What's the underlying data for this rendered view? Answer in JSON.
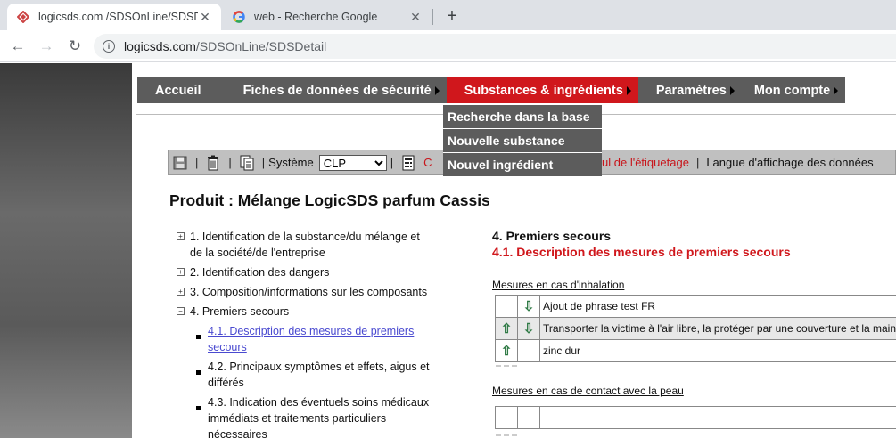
{
  "browser": {
    "tabs": [
      {
        "title": "logicsds.com /SDSOnLine/SDSDe",
        "active": true
      },
      {
        "title": "web - Recherche Google",
        "active": false
      }
    ],
    "url_host": "logicsds.com",
    "url_path": "/SDSOnLine/SDSDetail"
  },
  "menu": {
    "items": [
      {
        "label": "Accueil",
        "has_arrow": false
      },
      {
        "label": "Fiches de données de sécurité",
        "has_arrow": true
      },
      {
        "label": "Substances & ingrédients",
        "has_arrow": true,
        "active": true
      },
      {
        "label": "Paramètres",
        "has_arrow": true
      },
      {
        "label": "Mon compte",
        "has_arrow": true
      }
    ],
    "dropdown": [
      "Recherche dans la base",
      "Nouvelle substance",
      "Nouvel ingrédient"
    ]
  },
  "actionbar": {
    "system_label": "Système",
    "system_value": "CLP",
    "red_prefix": "C",
    "calc_label": "cul de l'étiquetage",
    "language_label": "Langue d'affichage des données"
  },
  "product": {
    "title": "Produit : Mélange LogicSDS parfum Cassis"
  },
  "toc": {
    "sections": [
      {
        "label": "1. Identification de la substance/du mélange et de la société/de l'entreprise",
        "toggle": "+"
      },
      {
        "label": "2. Identification des dangers",
        "toggle": "+"
      },
      {
        "label": "3. Composition/informations sur les composants",
        "toggle": "+"
      },
      {
        "label": "4. Premiers secours",
        "toggle": "−"
      }
    ],
    "subs": [
      {
        "label": "4.1. Description des mesures de premiers secours",
        "link": true
      },
      {
        "label": "4.2. Principaux symptômes et effets, aigus et différés",
        "link": false
      },
      {
        "label": "4.3. Indication des éventuels soins médicaux immédiats et traitements particuliers nécessaires",
        "link": false
      }
    ]
  },
  "detail": {
    "section_title": "4. Premiers secours",
    "subsection_title": "4.1. Description des mesures de premiers secours",
    "groups": [
      {
        "label": "Mesures en cas d'inhalation",
        "rows": [
          {
            "text": "Ajout de phrase test FR",
            "up": false,
            "down": true
          },
          {
            "text": "Transporter la victime à l'air libre, la protéger par une couverture et la maintenir",
            "up": true,
            "down": true,
            "highlight": true
          },
          {
            "text": "zinc dur",
            "up": true,
            "down": false
          }
        ]
      },
      {
        "label": "Mesures en cas de contact avec la peau",
        "rows": [
          {
            "text": "",
            "up": false,
            "down": false
          }
        ]
      }
    ]
  }
}
